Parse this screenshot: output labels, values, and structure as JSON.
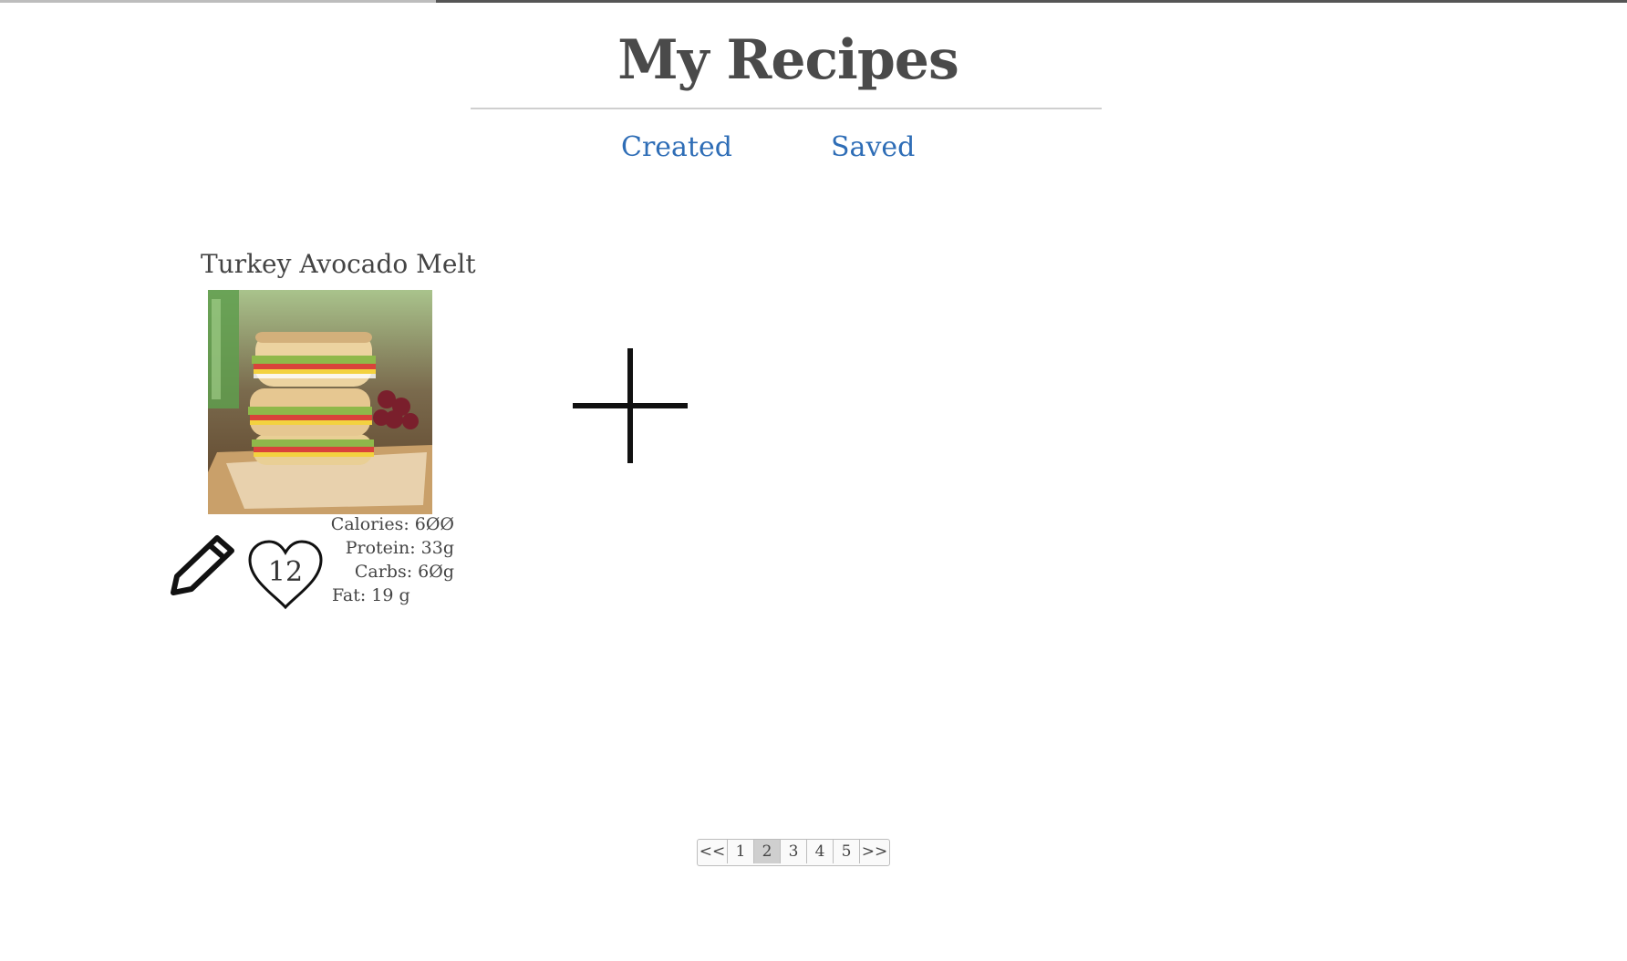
{
  "header": {
    "title": "My Recipes"
  },
  "tabs": [
    {
      "label": "Created"
    },
    {
      "label": "Saved"
    }
  ],
  "recipe": {
    "title": "Turkey Avocado Melt",
    "image_icon": "sandwich-photo",
    "likes": "12",
    "nutrition": {
      "calories": "Calories: 6ØØ",
      "protein": "Protein: 33g",
      "carbs": "Carbs: 6Øg",
      "fat": "Fat: 19 g"
    }
  },
  "add_button": {
    "icon": "plus-icon"
  },
  "pagination": {
    "first": "<<",
    "pages": [
      "1",
      "2",
      "3",
      "4",
      "5"
    ],
    "current": "2",
    "last": ">>"
  },
  "colors": {
    "link": "#2e6db6",
    "text": "#444444",
    "divider": "#cfcfcf",
    "current_page_bg": "#cfcfcf"
  }
}
